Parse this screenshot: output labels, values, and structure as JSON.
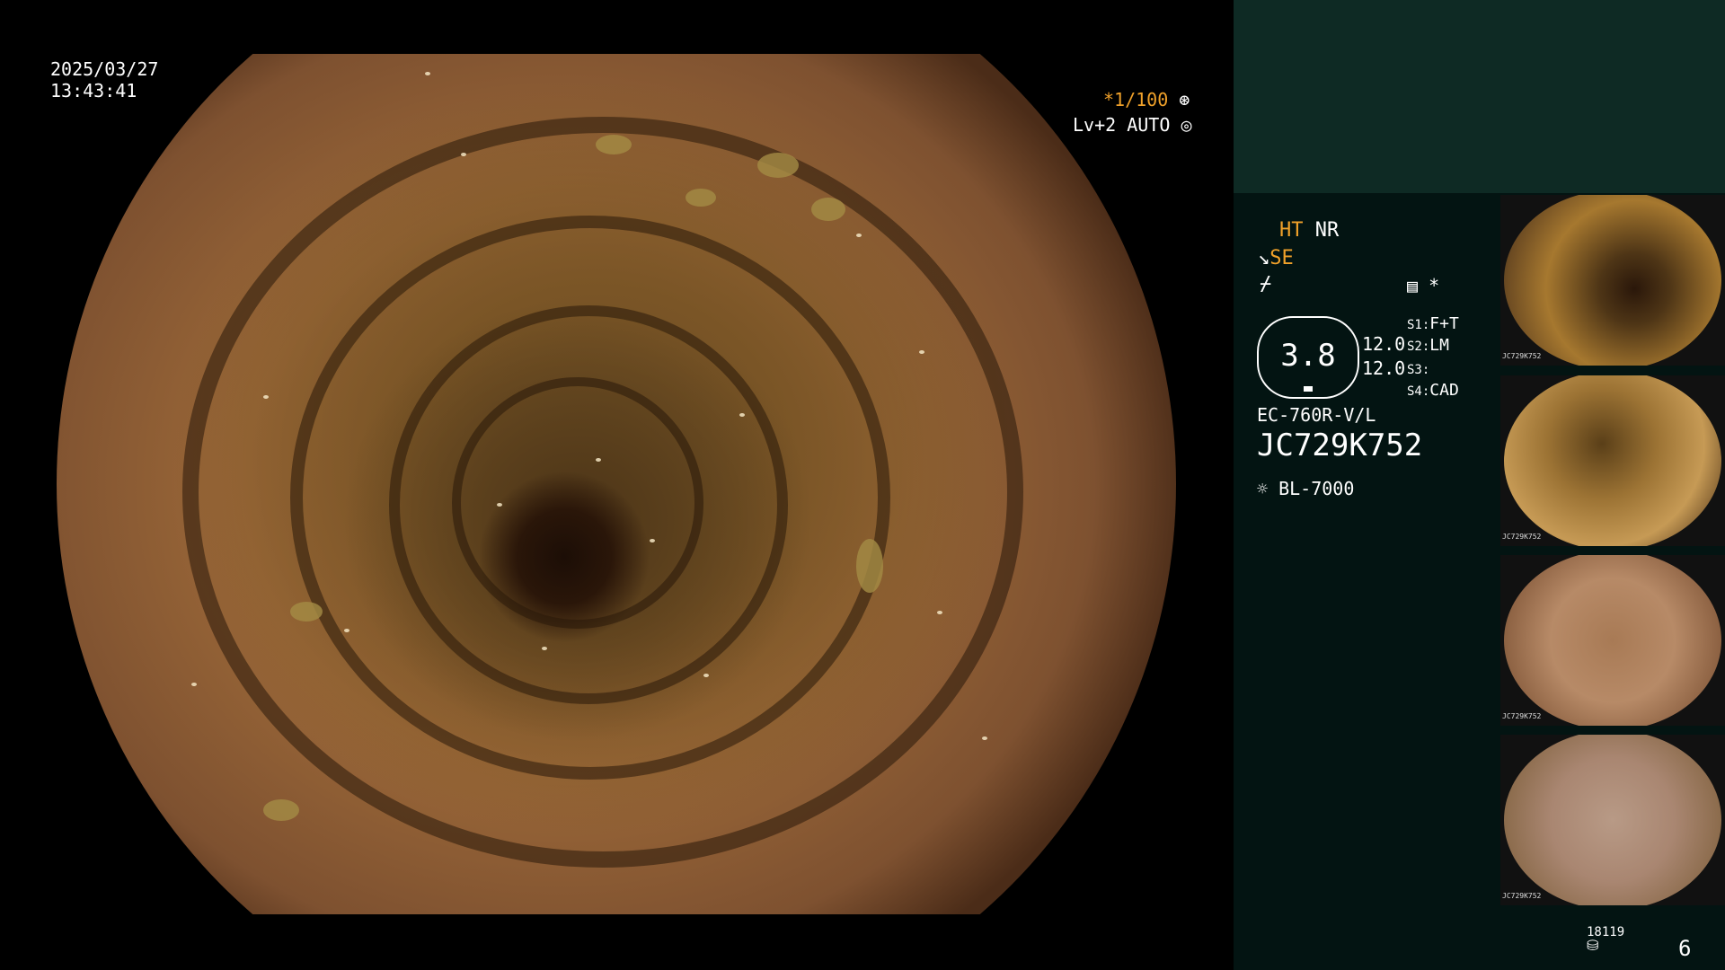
{
  "overlay": {
    "date": "2025/03/27",
    "time": "13:43:41",
    "shutter": "*1/100",
    "level": "Lv+2",
    "auto": "AUTO"
  },
  "panel": {
    "mode_ht": "HT",
    "mode_nr": "NR",
    "mode_se": "SE",
    "zoom_value": "3.8",
    "val_1": "12.0",
    "val_2": "12.0",
    "s1_label": "S1:",
    "s1_value": "F+T",
    "s2_label": "S2:",
    "s2_value": "LM",
    "s3_label": "S3:",
    "s3_value": "",
    "s4_label": "S4:",
    "s4_value": "CAD",
    "asterisk": "*",
    "scope_model": "EC-760R-V/L",
    "scope_serial": "JC729K752",
    "light_source": "BL-7000",
    "disk_count": "18119",
    "image_count": "6"
  },
  "thumbnails": [
    {
      "label": "JC729K752"
    },
    {
      "label": "JC729K752"
    },
    {
      "label": "JC729K752"
    },
    {
      "label": "JC729K752"
    }
  ],
  "colors": {
    "accent_orange": "#f0a12a",
    "panel_dark": "#031412",
    "panel_teal": "#0e2a24"
  }
}
